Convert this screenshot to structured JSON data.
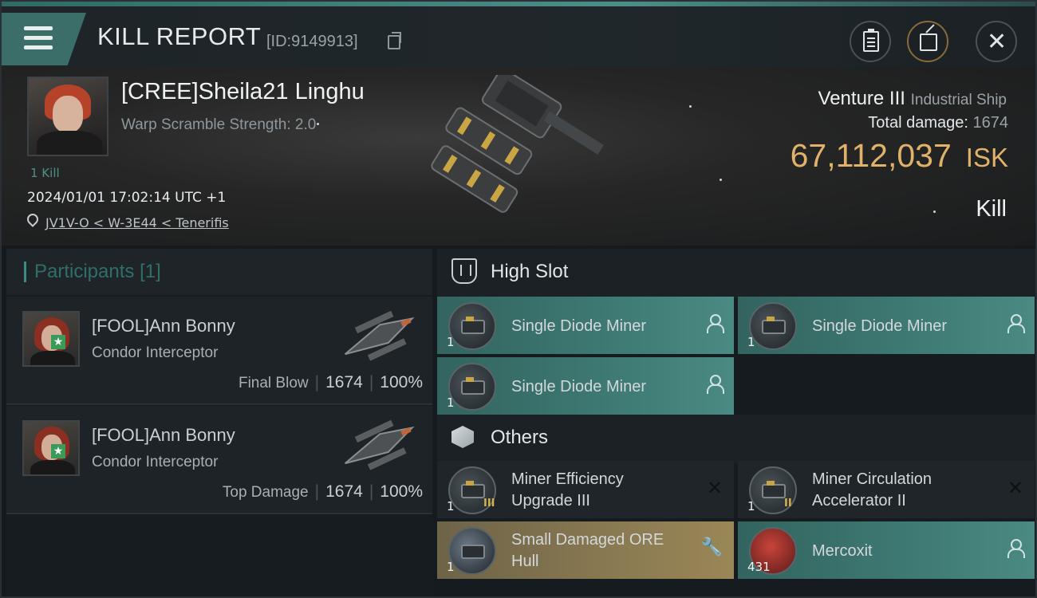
{
  "header": {
    "title": "KILL REPORT",
    "kill_id": "[ID:9149913]"
  },
  "victim": {
    "name": "[CREE]Sheila21 Linghu",
    "warp_scramble": "Warp Scramble Strength: 2.0",
    "kills": "1 Kill",
    "datetime": "2024/01/01 17:02:14 UTC +1",
    "location": "JV1V-O < W-3E44 < Tenerifis",
    "ship_name": "Venture III",
    "ship_class": "Industrial Ship",
    "total_damage_label": "Total damage:",
    "total_damage_value": "1674",
    "isk_value": "67,112,037",
    "isk_unit": "ISK",
    "result": "Kill"
  },
  "participants": {
    "title": "Participants",
    "count": "[1]",
    "rows": [
      {
        "name": "[FOOL]Ann Bonny",
        "ship": "Condor Interceptor",
        "role": "Final Blow",
        "damage": "1674",
        "percent": "100%"
      },
      {
        "name": "[FOOL]Ann Bonny",
        "ship": "Condor Interceptor",
        "role": "Top Damage",
        "damage": "1674",
        "percent": "100%"
      }
    ]
  },
  "fitting": {
    "high_slot_label": "High Slot",
    "others_label": "Others",
    "high_slot_items": [
      {
        "name": "Single Diode Miner",
        "qty": "1",
        "status": "dropped"
      },
      {
        "name": "Single Diode Miner",
        "qty": "1",
        "status": "dropped"
      },
      {
        "name": "Single Diode Miner",
        "qty": "1",
        "status": "dropped"
      }
    ],
    "other_items": [
      {
        "name_line1": "Miner Efficiency",
        "name_line2": "Upgrade III",
        "qty": "1",
        "tier": "III",
        "status": "destroyed"
      },
      {
        "name_line1": "Miner Circulation",
        "name_line2": "Accelerator II",
        "qty": "1",
        "tier": "II",
        "status": "destroyed"
      },
      {
        "name_line1": "Small Damaged ORE",
        "name_line2": "Hull",
        "qty": "1",
        "tier": "",
        "status": "salvage"
      },
      {
        "name_line1": "Mercoxit",
        "name_line2": "",
        "qty": "431",
        "tier": "",
        "status": "dropped"
      }
    ]
  },
  "colors": {
    "accent_teal": "#3f7a74",
    "isk_gold": "#e0b26a",
    "salvage_gold": "#8a7a52"
  },
  "icons": {
    "menu": "hamburger-icon",
    "copy": "copy-icon",
    "clipboard": "clipboard-icon",
    "share": "share-icon",
    "close": "close-icon",
    "high_slot": "high-slot-icon",
    "others": "cargo-box-icon",
    "dropped": "person-icon",
    "destroyed": "x-icon",
    "salvage": "wrench-icon"
  }
}
